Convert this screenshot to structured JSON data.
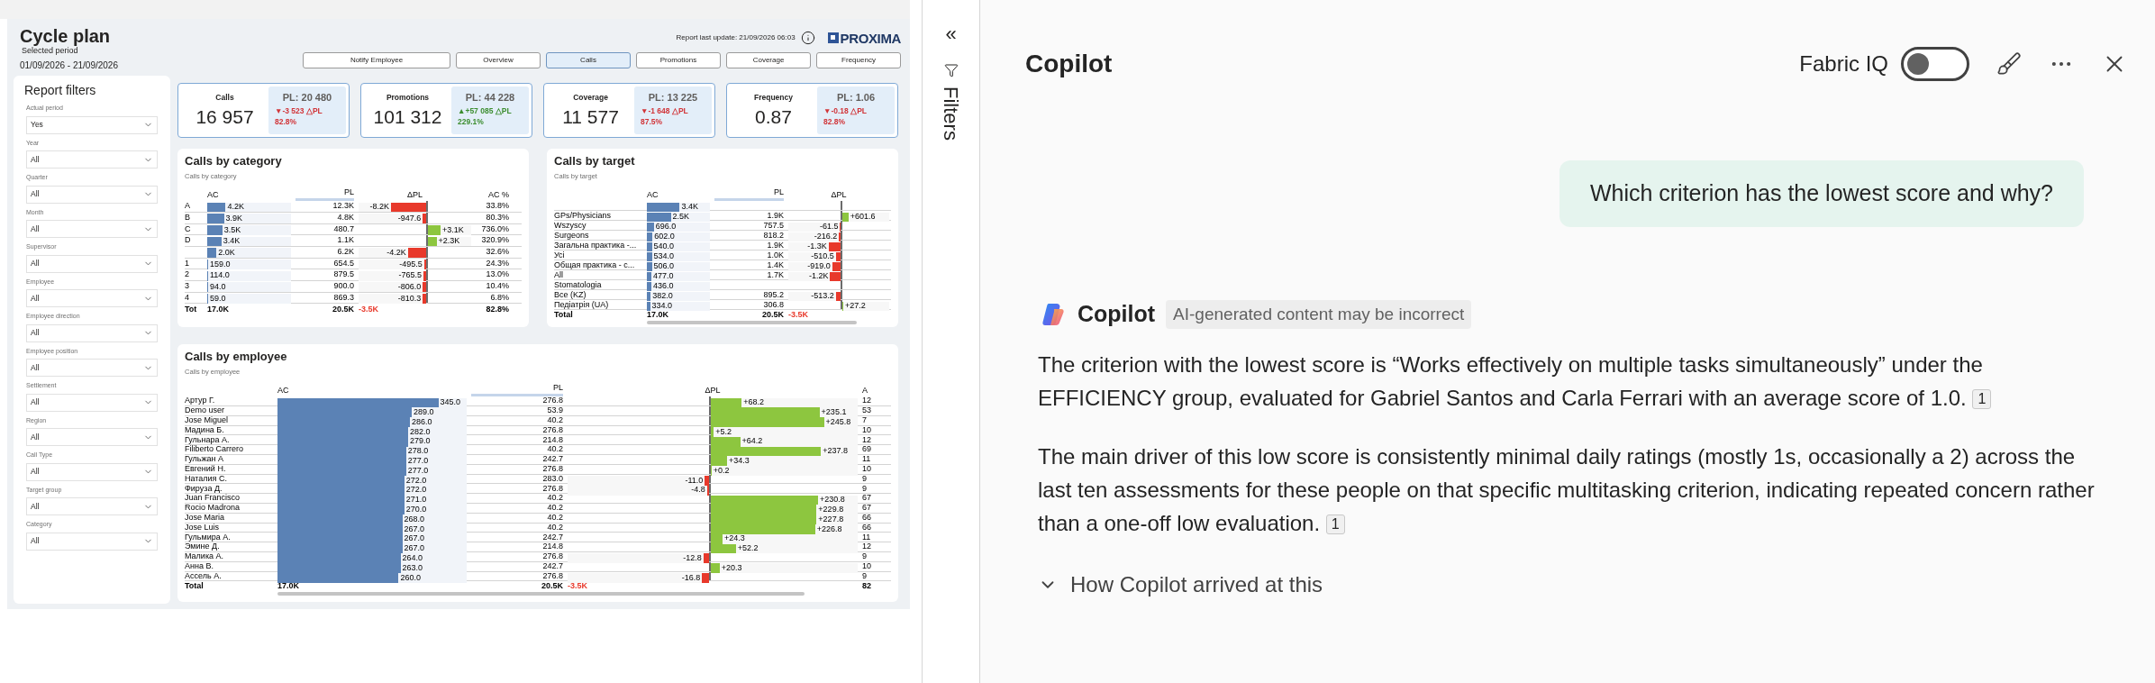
{
  "report": {
    "title": "Cycle plan",
    "period_label": "Selected period",
    "period": "01/09/2026 - 21/09/2026",
    "last_update": "Report last update: 21/09/2026 06:03",
    "logo": "PROXIMA",
    "nav": [
      {
        "label": "Notify Employee",
        "selected": false
      },
      {
        "label": "Overview",
        "selected": false
      },
      {
        "label": "Calls",
        "selected": true
      },
      {
        "label": "Promotions",
        "selected": false
      },
      {
        "label": "Coverage",
        "selected": false
      },
      {
        "label": "Frequency",
        "selected": false
      }
    ],
    "filters": {
      "title": "Report filters",
      "items": [
        {
          "label": "Actual period",
          "value": "Yes"
        },
        {
          "label": "Year",
          "value": "All"
        },
        {
          "label": "Quarter",
          "value": "All"
        },
        {
          "label": "Month",
          "value": "All"
        },
        {
          "label": "Supervisor",
          "value": "All"
        },
        {
          "label": "Employee",
          "value": "All"
        },
        {
          "label": "Employee direction",
          "value": "All"
        },
        {
          "label": "Employee position",
          "value": "All"
        },
        {
          "label": "Settlement",
          "value": "All"
        },
        {
          "label": "Region",
          "value": "All"
        },
        {
          "label": "Call Type",
          "value": "All"
        },
        {
          "label": "Target group",
          "value": "All"
        },
        {
          "label": "Category",
          "value": "All"
        }
      ]
    },
    "kpis": [
      {
        "title": "Calls",
        "value": "16 957",
        "plan": "PL: 20 480",
        "delta": "▼-3 523 △PL",
        "pct": "82.8%",
        "kind": "negative"
      },
      {
        "title": "Promotions",
        "value": "101 312",
        "plan": "PL: 44 228",
        "delta": "▲+57 085 △PL",
        "pct": "229.1%",
        "kind": "positive"
      },
      {
        "title": "Coverage",
        "value": "11 577",
        "plan": "PL: 13 225",
        "delta": "▼-1 648 △PL",
        "pct": "87.5%",
        "kind": "negative"
      },
      {
        "title": "Frequency",
        "value": "0.87",
        "plan": "PL: 1.06",
        "delta": "▼-0.18 △PL",
        "pct": "82.8%",
        "kind": "negative"
      }
    ],
    "category": {
      "title": "Calls by category",
      "subtitle": "Calls by category",
      "columns": [
        "AC",
        "PL",
        "ΔPL",
        "AC %"
      ],
      "rows": [
        {
          "label": "A",
          "ac": {
            "value": "4.2K",
            "level": 0.22
          },
          "pl": "12.3K",
          "delta": {
            "value": "-8.2K",
            "level": 0.52,
            "kind": "negative"
          },
          "ac_pct": "33.8%"
        },
        {
          "label": "B",
          "ac": {
            "value": "3.9K",
            "level": 0.2
          },
          "pl": "4.8K",
          "delta": {
            "value": "-947.6",
            "level": 0.05,
            "kind": "negative"
          },
          "ac_pct": "80.3%"
        },
        {
          "label": "C",
          "ac": {
            "value": "3.5K",
            "level": 0.18
          },
          "pl": "480.7",
          "delta": {
            "value": "+3.1K",
            "level": 0.29,
            "kind": "positive"
          },
          "ac_pct": "736.0%"
        },
        {
          "label": "D",
          "ac": {
            "value": "3.4K",
            "level": 0.17
          },
          "pl": "1.1K",
          "delta": {
            "value": "+2.3K",
            "level": 0.2,
            "kind": "positive"
          },
          "ac_pct": "320.9%"
        },
        {
          "ac": {
            "value": "2.0K",
            "level": 0.11
          },
          "pl": "6.2K",
          "delta": {
            "value": "-4.2K",
            "level": 0.27,
            "kind": "negative"
          },
          "ac_pct": "32.6%"
        },
        {
          "label": "1",
          "ac": {
            "value": "159.0",
            "level": 0.01
          },
          "pl": "654.5",
          "delta": {
            "value": "-495.5",
            "level": 0.03,
            "kind": "negative"
          },
          "ac_pct": "24.3%"
        },
        {
          "label": "2",
          "ac": {
            "value": "114.0",
            "level": 0.01
          },
          "pl": "879.5",
          "delta": {
            "value": "-765.5",
            "level": 0.04,
            "kind": "negative"
          },
          "ac_pct": "13.0%"
        },
        {
          "label": "3",
          "ac": {
            "value": "94.0",
            "level": 0.01
          },
          "pl": "900.0",
          "delta": {
            "value": "-806.0",
            "level": 0.05,
            "kind": "negative"
          },
          "ac_pct": "10.4%"
        },
        {
          "label": "4",
          "ac": {
            "value": "59.0",
            "level": 0.01
          },
          "pl": "869.3",
          "delta": {
            "value": "-810.3",
            "level": 0.05,
            "kind": "negative"
          },
          "ac_pct": "6.8%"
        }
      ],
      "total": {
        "label": "Tot",
        "ac": "17.0K",
        "pl": "20.5K",
        "delta": {
          "value": "-3.5K",
          "kind": "negative"
        },
        "ac_pct": "82.8%"
      }
    },
    "target": {
      "title": "Calls by target",
      "subtitle": "Calls by target",
      "columns": [
        "AC",
        "PL",
        "ΔPL"
      ],
      "rows": [
        {
          "ac": {
            "value": "3.4K",
            "level": 0.52
          }
        },
        {
          "label": "GPs/Physicians",
          "ac": {
            "value": "2.5K",
            "level": 0.38
          },
          "pl": "1.9K",
          "delta": {
            "value": "+601.6",
            "level": 0.13,
            "kind": "positive"
          }
        },
        {
          "label": "Wszyscy",
          "ac": {
            "value": "696.0",
            "level": 0.11
          },
          "pl": "757.5",
          "delta": {
            "value": "-61.5",
            "level": 0.01,
            "kind": "negative"
          }
        },
        {
          "label": "Surgeons",
          "ac": {
            "value": "602.0",
            "level": 0.09
          },
          "pl": "818.2",
          "delta": {
            "value": "-216.2",
            "level": 0.03,
            "kind": "negative"
          }
        },
        {
          "label": "Загальна практика -...",
          "ac": {
            "value": "540.0",
            "level": 0.08
          },
          "pl": "1.9K",
          "delta": {
            "value": "-1.3K",
            "level": 0.23,
            "kind": "negative"
          }
        },
        {
          "label": "Усі",
          "ac": {
            "value": "534.0",
            "level": 0.08
          },
          "pl": "1.0K",
          "delta": {
            "value": "-510.5",
            "level": 0.09,
            "kind": "negative"
          }
        },
        {
          "label": "Общая практика - с...",
          "ac": {
            "value": "506.0",
            "level": 0.08
          },
          "pl": "1.4K",
          "delta": {
            "value": "-919.0",
            "level": 0.16,
            "kind": "negative"
          }
        },
        {
          "label": "All",
          "ac": {
            "value": "477.0",
            "level": 0.07
          },
          "pl": "1.7K",
          "delta": {
            "value": "-1.2K",
            "level": 0.2,
            "kind": "negative"
          }
        },
        {
          "label": "Stomatologia",
          "ac": {
            "value": "436.0",
            "level": 0.07
          }
        },
        {
          "label": "Все (KZ)",
          "ac": {
            "value": "382.0",
            "level": 0.06
          },
          "pl": "895.2",
          "delta": {
            "value": "-513.2",
            "level": 0.09,
            "kind": "negative"
          }
        },
        {
          "label": "Педіатрія (UA)",
          "ac": {
            "value": "334.0",
            "level": 0.05
          },
          "pl": "306.8",
          "delta": {
            "value": "+27.2",
            "level": 0.02,
            "kind": "positive"
          }
        }
      ],
      "total": {
        "label": "Total",
        "ac": "17.0K",
        "pl": "20.5K",
        "delta": {
          "value": "-3.5K",
          "kind": "negative"
        }
      }
    },
    "employee": {
      "title": "Calls by employee",
      "subtitle": "Calls by employee",
      "columns": [
        "AC",
        "PL",
        "ΔPL",
        "A"
      ],
      "rows": [
        {
          "label": "Артур Г.",
          "ac": {
            "value": "345.0",
            "level": 0.85
          },
          "pl": "276.8",
          "delta": {
            "value": "+68.2",
            "level": 0.21,
            "kind": "positive"
          },
          "column_5": "12"
        },
        {
          "label": "Demo user",
          "ac": {
            "value": "289.0",
            "level": 0.71
          },
          "pl": "53.9",
          "delta": {
            "value": "+235.1",
            "level": 0.74,
            "kind": "positive"
          },
          "column_5": "53"
        },
        {
          "label": "Jose Miguel",
          "ac": {
            "value": "286.0",
            "level": 0.7
          },
          "pl": "40.2",
          "delta": {
            "value": "+245.8",
            "level": 0.77,
            "kind": "positive"
          },
          "column_5": "7"
        },
        {
          "label": "Мадина Б.",
          "ac": {
            "value": "282.0",
            "level": 0.69
          },
          "pl": "276.8",
          "delta": {
            "value": "+5.2",
            "level": 0.02,
            "kind": "positive"
          },
          "column_5": "10"
        },
        {
          "label": "Гульнара А.",
          "ac": {
            "value": "279.0",
            "level": 0.69
          },
          "pl": "214.8",
          "delta": {
            "value": "+64.2",
            "level": 0.2,
            "kind": "positive"
          },
          "column_5": "12"
        },
        {
          "label": "Filiberto Carrero",
          "ac": {
            "value": "278.0",
            "level": 0.68
          },
          "pl": "40.2",
          "delta": {
            "value": "+237.8",
            "level": 0.75,
            "kind": "positive"
          },
          "column_5": "69"
        },
        {
          "label": "Гульжан А",
          "ac": {
            "value": "277.0",
            "level": 0.68
          },
          "pl": "242.7",
          "delta": {
            "value": "+34.3",
            "level": 0.11,
            "kind": "positive"
          },
          "column_5": "11"
        },
        {
          "label": "Евгений Н.",
          "ac": {
            "value": "277.0",
            "level": 0.68
          },
          "pl": "276.8",
          "delta": {
            "value": "+0.2",
            "level": 0.005,
            "kind": "positive"
          },
          "column_5": "10"
        },
        {
          "label": "Наталия С.",
          "ac": {
            "value": "272.0",
            "level": 0.67
          },
          "pl": "283.0",
          "delta": {
            "value": "-11.0",
            "level": 0.03,
            "kind": "negative"
          },
          "column_5": "9"
        },
        {
          "label": "Фируза Д.",
          "ac": {
            "value": "272.0",
            "level": 0.67
          },
          "pl": "276.8",
          "delta": {
            "value": "-4.8",
            "level": 0.015,
            "kind": "negative"
          },
          "column_5": "9"
        },
        {
          "label": "Juan Francisco",
          "ac": {
            "value": "271.0",
            "level": 0.67
          },
          "pl": "40.2",
          "delta": {
            "value": "+230.8",
            "level": 0.73,
            "kind": "positive"
          },
          "column_5": "67"
        },
        {
          "label": "Rocio Madrona",
          "ac": {
            "value": "270.0",
            "level": 0.67
          },
          "pl": "40.2",
          "delta": {
            "value": "+229.8",
            "level": 0.72,
            "kind": "positive"
          },
          "column_5": "67"
        },
        {
          "label": "Jose Maria",
          "ac": {
            "value": "268.0",
            "level": 0.66
          },
          "pl": "40.2",
          "delta": {
            "value": "+227.8",
            "level": 0.72,
            "kind": "positive"
          },
          "column_5": "66"
        },
        {
          "label": "Jose Luis",
          "ac": {
            "value": "267.0",
            "level": 0.66
          },
          "pl": "40.2",
          "delta": {
            "value": "+226.8",
            "level": 0.71,
            "kind": "positive"
          },
          "column_5": "66"
        },
        {
          "label": "Гульмира А.",
          "ac": {
            "value": "267.0",
            "level": 0.66
          },
          "pl": "242.7",
          "delta": {
            "value": "+24.3",
            "level": 0.08,
            "kind": "positive"
          },
          "column_5": "11"
        },
        {
          "label": "Эмине Д.",
          "ac": {
            "value": "267.0",
            "level": 0.66
          },
          "pl": "214.8",
          "delta": {
            "value": "+52.2",
            "level": 0.17,
            "kind": "positive"
          },
          "column_5": "12"
        },
        {
          "label": "Малика А.",
          "ac": {
            "value": "264.0",
            "level": 0.65
          },
          "pl": "276.8",
          "delta": {
            "value": "-12.8",
            "level": 0.04,
            "kind": "negative"
          },
          "column_5": "9"
        },
        {
          "label": "Анна В.",
          "ac": {
            "value": "263.0",
            "level": 0.65
          },
          "pl": "242.7",
          "delta": {
            "value": "+20.3",
            "level": 0.06,
            "kind": "positive"
          },
          "column_5": "10"
        },
        {
          "label": "Ассель А.",
          "ac": {
            "value": "260.0",
            "level": 0.64
          },
          "pl": "276.8",
          "delta": {
            "value": "-16.8",
            "level": 0.05,
            "kind": "negative"
          },
          "column_5": "9"
        }
      ],
      "total": {
        "label": "Total",
        "ac": "17.0K",
        "pl": "20.5K",
        "delta": {
          "value": "-3.5K",
          "kind": "negative"
        },
        "column_5": "82"
      }
    }
  },
  "filters_pane": {
    "collapse": "«",
    "label": "Filters"
  },
  "copilot": {
    "title": "Copilot",
    "toggle": {
      "label": "Fabric IQ",
      "on": false
    },
    "user_message": "Which criterion has the lowest score and why?",
    "author": "Copilot",
    "disclaimer": "AI-generated content may be incorrect",
    "paragraphs": [
      {
        "text": "The criterion with the lowest score is “Works effectively on multiple tasks simultaneously” under the EFFICIENCY group, evaluated for Gabriel Santos and Carla Ferrari with an average score of 1.0.",
        "citation": "1"
      },
      {
        "text": "The main driver of this low score is consistently minimal daily ratings (mostly 1s, occasionally a 2) across the last ten assessments for these people on that specific multitasking criterion, indicating repeated concern rather than a one-off low evaluation.",
        "citation": "1"
      }
    ],
    "reasoning": {
      "label": "How Copilot arrived at this",
      "expanded": false
    }
  }
}
